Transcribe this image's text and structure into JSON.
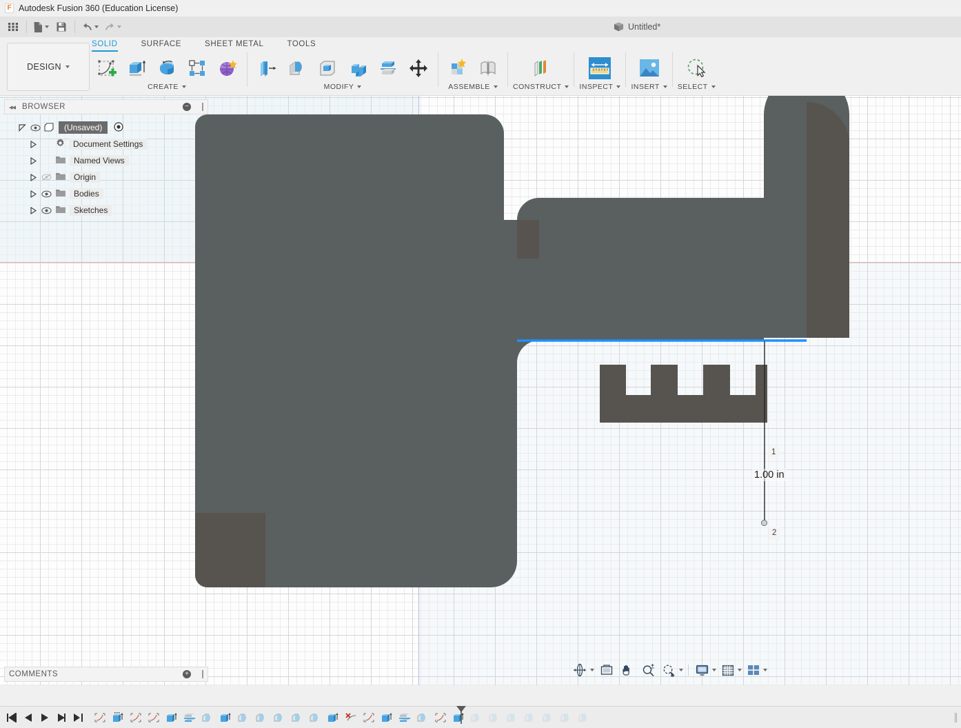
{
  "window": {
    "app_title": "Autodesk Fusion 360 (Education License)",
    "logo_letter": "F",
    "document_tab": "Untitled*"
  },
  "quick_access": {
    "items": [
      {
        "name": "app-grid",
        "label": "Show Data Panel"
      },
      {
        "name": "new-file",
        "label": "File"
      },
      {
        "name": "save",
        "label": "Save"
      },
      {
        "name": "undo",
        "label": "Undo"
      },
      {
        "name": "redo",
        "label": "Redo"
      }
    ]
  },
  "ribbon": {
    "workspace": "DESIGN",
    "tabs": [
      {
        "label": "SOLID",
        "active": true
      },
      {
        "label": "SURFACE",
        "active": false
      },
      {
        "label": "SHEET METAL",
        "active": false
      },
      {
        "label": "TOOLS",
        "active": false
      }
    ],
    "groups": [
      {
        "label": "CREATE",
        "has_dropdown": true,
        "tools": [
          "create-sketch-icon",
          "extrude-icon",
          "revolve-icon",
          "pattern-icon",
          "form-icon"
        ]
      },
      {
        "label": "MODIFY",
        "has_dropdown": true,
        "tools": [
          "press-pull-icon",
          "fillet-icon",
          "shell-icon",
          "combine-icon",
          "split-face-icon",
          "move-copy-icon"
        ]
      },
      {
        "label": "ASSEMBLE",
        "has_dropdown": true,
        "tools": [
          "new-component-icon",
          "joint-icon"
        ]
      },
      {
        "label": "CONSTRUCT",
        "has_dropdown": true,
        "tools": [
          "offset-plane-icon"
        ]
      },
      {
        "label": "INSPECT",
        "has_dropdown": true,
        "tools": [
          "measure-icon"
        ],
        "active": true
      },
      {
        "label": "INSERT",
        "has_dropdown": true,
        "tools": [
          "insert-image-icon"
        ]
      },
      {
        "label": "SELECT",
        "has_dropdown": true,
        "tools": [
          "select-icon"
        ]
      }
    ]
  },
  "browser": {
    "title": "BROWSER",
    "collapse_glyph": "◂◂",
    "root": {
      "label": "(Unsaved)",
      "icon": "component-icon",
      "visibility_icon": "eye-icon",
      "radio_icon": "activate-icon"
    },
    "items": [
      {
        "label": "Document Settings",
        "icon": "gear-icon",
        "visibility": "none"
      },
      {
        "label": "Named Views",
        "icon": "folder-icon",
        "visibility": "none"
      },
      {
        "label": "Origin",
        "icon": "folder-icon",
        "visibility": "eye-off-icon"
      },
      {
        "label": "Bodies",
        "icon": "folder-icon",
        "visibility": "eye-icon"
      },
      {
        "label": "Sketches",
        "icon": "folder-icon",
        "visibility": "eye-icon"
      }
    ]
  },
  "comments": {
    "title": "COMMENTS",
    "add_glyph": "+"
  },
  "canvas": {
    "dimension": {
      "value": "1.00 in",
      "marker_1": "1",
      "marker_2": "2"
    },
    "colors": {
      "body_front": "#5a5f5f",
      "body_side": "#57534f",
      "highlight_edge": "#1e90ff",
      "axis_x": "#eeb1b1",
      "axis_y": "#b3b8e8",
      "grid_minor": "#ebebeb",
      "grid_major": "#d5d5d5"
    }
  },
  "navbar": {
    "items": [
      {
        "name": "orbit-icon",
        "label": "Orbit",
        "dropdown": true
      },
      {
        "name": "look-at-icon",
        "label": "Look At",
        "dropdown": false
      },
      {
        "name": "pan-icon",
        "label": "Pan",
        "dropdown": false
      },
      {
        "name": "zoom-icon",
        "label": "Zoom",
        "dropdown": false
      },
      {
        "name": "zoom-window-icon",
        "label": "Fit",
        "dropdown": true
      },
      {
        "name": "display-settings-icon",
        "label": "Display Settings",
        "dropdown": true
      },
      {
        "name": "grid-snaps-icon",
        "label": "Grid and Snaps",
        "dropdown": true
      },
      {
        "name": "viewports-icon",
        "label": "Viewports",
        "dropdown": true
      }
    ]
  },
  "timeline": {
    "controls": [
      "go-to-beginning-icon",
      "step-back-icon",
      "play-icon",
      "step-forward-icon",
      "go-to-end-icon"
    ],
    "features": [
      {
        "icon": "sketch-icon",
        "state": "done"
      },
      {
        "icon": "extrude-icon",
        "state": "done",
        "marked": true
      },
      {
        "icon": "sketch-icon",
        "state": "done"
      },
      {
        "icon": "sketch-icon",
        "state": "done"
      },
      {
        "icon": "extrude-icon",
        "state": "done"
      },
      {
        "icon": "split-icon",
        "state": "done"
      },
      {
        "icon": "fillet-icon",
        "state": "done"
      },
      {
        "icon": "extrude-icon",
        "state": "done"
      },
      {
        "icon": "fillet-icon",
        "state": "done"
      },
      {
        "icon": "fillet-icon",
        "state": "done"
      },
      {
        "icon": "fillet-icon",
        "state": "done"
      },
      {
        "icon": "fillet-icon",
        "state": "done"
      },
      {
        "icon": "fillet-icon",
        "state": "done"
      },
      {
        "icon": "extrude-icon",
        "state": "done"
      },
      {
        "icon": "delete-icon",
        "state": "done"
      },
      {
        "icon": "sketch-icon",
        "state": "done"
      },
      {
        "icon": "extrude-icon",
        "state": "done"
      },
      {
        "icon": "split-icon",
        "state": "done"
      },
      {
        "icon": "fillet-icon",
        "state": "done"
      },
      {
        "icon": "sketch-icon",
        "state": "done"
      },
      {
        "icon": "extrude-icon",
        "state": "current"
      },
      {
        "icon": "fillet-icon",
        "state": "future"
      },
      {
        "icon": "fillet-icon",
        "state": "future"
      },
      {
        "icon": "fillet-icon",
        "state": "future"
      },
      {
        "icon": "fillet-icon",
        "state": "future"
      },
      {
        "icon": "fillet-icon",
        "state": "future"
      },
      {
        "icon": "fillet-icon",
        "state": "future"
      },
      {
        "icon": "fillet-icon",
        "state": "future"
      }
    ]
  }
}
